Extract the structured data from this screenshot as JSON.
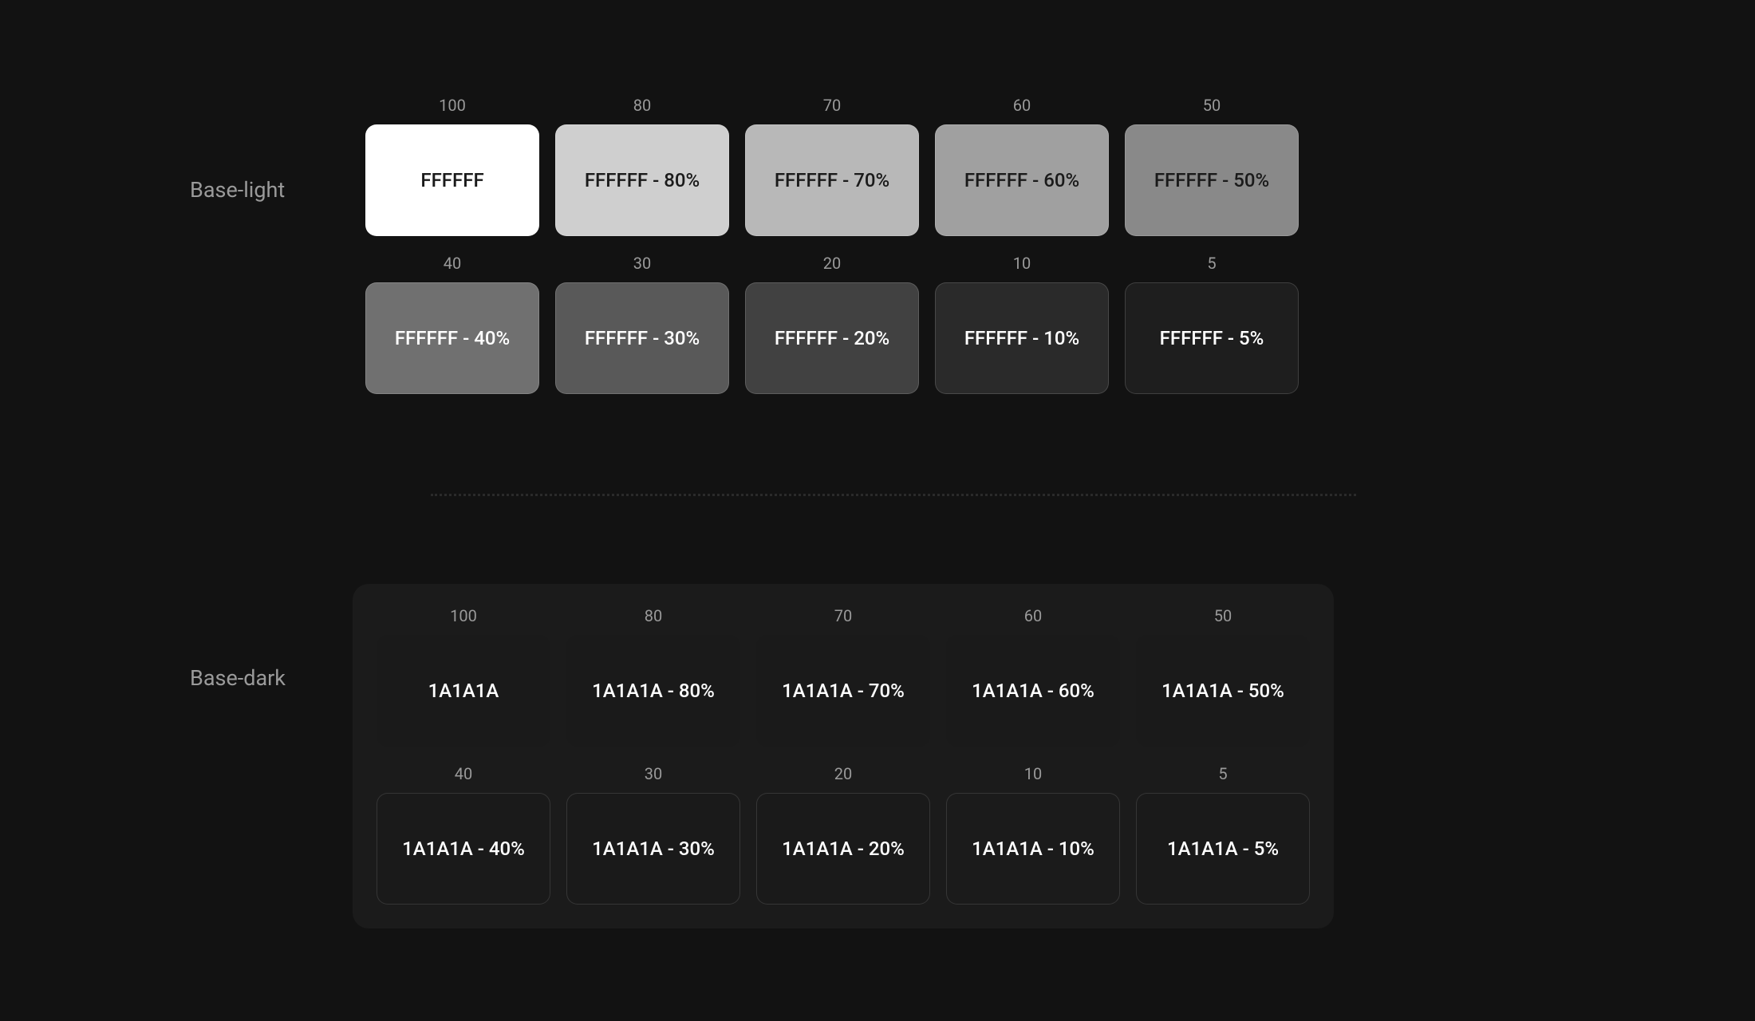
{
  "light": {
    "label": "Base-light",
    "swatches": [
      {
        "number": "100",
        "label": "FFFFFF"
      },
      {
        "number": "80",
        "label": "FFFFFF - 80%"
      },
      {
        "number": "70",
        "label": "FFFFFF - 70%"
      },
      {
        "number": "60",
        "label": "FFFFFF - 60%"
      },
      {
        "number": "50",
        "label": "FFFFFF - 50%"
      },
      {
        "number": "40",
        "label": "FFFFFF - 40%"
      },
      {
        "number": "30",
        "label": "FFFFFF - 30%"
      },
      {
        "number": "20",
        "label": "FFFFFF - 20%"
      },
      {
        "number": "10",
        "label": "FFFFFF - 10%"
      },
      {
        "number": "5",
        "label": "FFFFFF - 5%"
      }
    ]
  },
  "dark": {
    "label": "Base-dark",
    "swatches": [
      {
        "number": "100",
        "label": "1A1A1A"
      },
      {
        "number": "80",
        "label": "1A1A1A - 80%"
      },
      {
        "number": "70",
        "label": "1A1A1A - 70%"
      },
      {
        "number": "60",
        "label": "1A1A1A - 60%"
      },
      {
        "number": "50",
        "label": "1A1A1A - 50%"
      },
      {
        "number": "40",
        "label": "1A1A1A - 40%"
      },
      {
        "number": "30",
        "label": "1A1A1A - 30%"
      },
      {
        "number": "20",
        "label": "1A1A1A - 20%"
      },
      {
        "number": "10",
        "label": "1A1A1A - 10%"
      },
      {
        "number": "5",
        "label": "1A1A1A - 5%"
      }
    ]
  }
}
